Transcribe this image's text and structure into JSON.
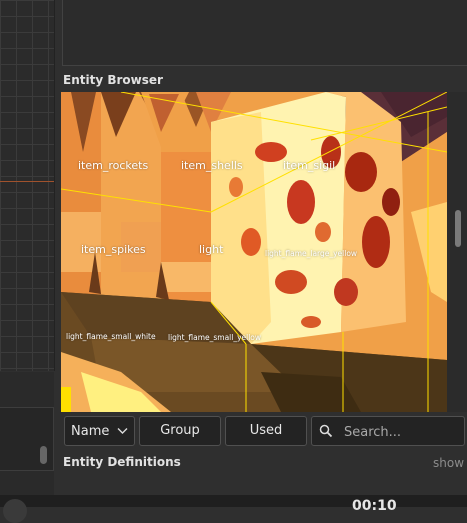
{
  "panels": {
    "entity_browser_title": "Entity Browser",
    "entity_definitions_title": "Entity Definitions",
    "show_label": "show"
  },
  "viewport": {
    "entity_labels": [
      "item_rockets",
      "item_shells",
      "item_sigil",
      "item_spikes",
      "light",
      "light_flame_large_yellow",
      "light_flame_small_white",
      "light_flame_small_yellow"
    ]
  },
  "toolbar": {
    "sort_value": "Name",
    "group_label": "Group",
    "used_label": "Used",
    "search_placeholder": "Search..."
  },
  "status": {
    "time_fragment": "00:10"
  },
  "icons": {
    "sort": "chevron-down-icon",
    "search": "search-icon"
  },
  "colors": {
    "background": "#2f2f2f",
    "lava_orange": "#f09a45",
    "selection_yellow": "#ffe000"
  }
}
